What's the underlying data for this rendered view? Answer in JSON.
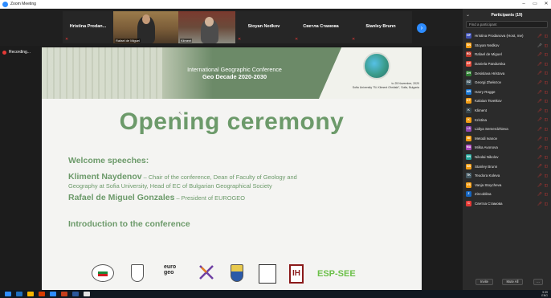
{
  "window": {
    "title": "Zoom Meeting"
  },
  "gallery": {
    "tiles": [
      {
        "name": "Hristina Prodan..."
      },
      {
        "name": "",
        "caption": "Rafael de Miguel"
      },
      {
        "name": "",
        "caption": "Kliment"
      },
      {
        "name": "Stoyan Nedkov"
      },
      {
        "name": "Светла Стамова"
      },
      {
        "name": "Stanley Brunn"
      }
    ]
  },
  "recording": {
    "label": "Recording..."
  },
  "slide": {
    "conference_title": "International Geographic Conference",
    "conference_subtitle": "Geo Decade 2020-2030",
    "date_line1": "to 25 November, 2020",
    "date_line2": "Sofia University \"St. Kliment Ohridski\", Sofia, Bulgaria",
    "heading": "Opening ceremony",
    "welcome": "Welcome speeches:",
    "speaker1_name": "Kliment Naydenov",
    "speaker1_role_a": " – Chair of the conference, Dean of Faculty of Geology and",
    "speaker1_role_b": "Geography at Sofia University, Head of EC of Bulgarian Geographical Society",
    "speaker2_name": "Rafael de Miguel Gonzales",
    "speaker2_role": " – President of EUROGEO",
    "intro": "Introduction to the conference",
    "logo_euro_a": "euro",
    "logo_euro_b": "geo",
    "logo_bh": "IH",
    "logo_esp": "ESP-SEE"
  },
  "panel": {
    "title": "Participants (19)",
    "search_placeholder": "Find a participant",
    "participants": [
      {
        "initials": "HP",
        "name": "Hristina Prodanova (Host, me)",
        "color": "#3f51b5"
      },
      {
        "initials": "SN",
        "name": "Stoyan Nedkov",
        "color": "#f39c12"
      },
      {
        "initials": "RD",
        "name": "Rafael de Miguel",
        "color": "#c0392b"
      },
      {
        "initials": "DP",
        "name": "Daniela Pandurska",
        "color": "#e74c3c"
      },
      {
        "initials": "DH",
        "name": "Desislava Hristova",
        "color": "#2e7d32"
      },
      {
        "initials": "GZ",
        "name": "Georgi Zhelezov",
        "color": "#455a64"
      },
      {
        "initials": "HR",
        "name": "Harry Rogge",
        "color": "#1976d2"
      },
      {
        "initials": "KT",
        "name": "Kaloian Tsvetkov",
        "color": "#f39c12"
      },
      {
        "initials": "K",
        "name": "Kliment",
        "color": "#37474f"
      },
      {
        "initials": "K",
        "name": "Kristina",
        "color": "#f39c12"
      },
      {
        "initials": "LS",
        "name": "Lidiya Semerdzhieva",
        "color": "#8e44ad"
      },
      {
        "initials": "MI",
        "name": "Metodi Ivanov",
        "color": "#f39c12"
      },
      {
        "initials": "MA",
        "name": "Milka Avonova",
        "color": "#ab47bc"
      },
      {
        "initials": "NN",
        "name": "Nikolai Nikolov",
        "color": "#26a69a"
      },
      {
        "initials": "SB",
        "name": "Stanley Brunn",
        "color": "#f39c12"
      },
      {
        "initials": "TK",
        "name": "Teodora Koleva",
        "color": "#455a64"
      },
      {
        "initials": "VS",
        "name": "Vanja Stoycheva",
        "color": "#f39c12"
      },
      {
        "initials": "Z",
        "name": "Zincoblina",
        "color": "#1565c0"
      },
      {
        "initials": "C",
        "name": "Светла Стамова",
        "color": "#e53935"
      }
    ],
    "invite_label": "Invite",
    "mute_all_label": "Mute All",
    "more_label": "..."
  },
  "tray": {
    "time": "9:39",
    "lang": "ENG"
  }
}
